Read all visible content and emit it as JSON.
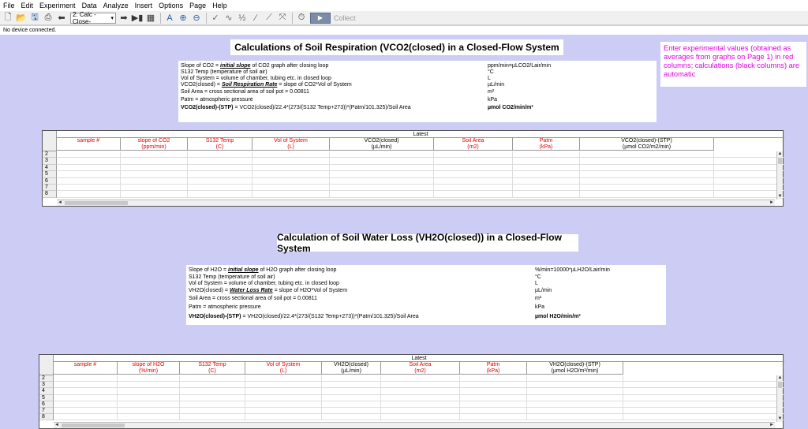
{
  "menu": [
    "File",
    "Edit",
    "Experiment",
    "Data",
    "Analyze",
    "Insert",
    "Options",
    "Page",
    "Help"
  ],
  "toolbar": {
    "page_select": "2: Calc - Close-",
    "collect_label": "Collect"
  },
  "status": "No device connected.",
  "section1": {
    "title": "Calculations of Soil Respiration (VCO2(closed) in a Closed-Flow System",
    "lines": [
      {
        "pre": "Slope of CO2 = ",
        "em": "initial slope",
        "post": " of CO2 graph after closing loop",
        "unit": "ppm/min=µLCO2/Lair/min"
      },
      {
        "pre": "S132 Temp (temperature of soil air)",
        "em": "",
        "post": "",
        "unit": "°C"
      },
      {
        "pre": "Vol of System = volume of chamber, tubing etc. in closed loop",
        "em": "",
        "post": "",
        "unit": "L"
      },
      {
        "pre": "VCO2(closed) = ",
        "em": "Soil Respiration Rate",
        "post": " = slope of CO2*Vol of System",
        "unit": "µL/min"
      },
      {
        "pre": "Soil Area = cross sectional area of soil pot = 0.00811",
        "em": "",
        "post": "",
        "unit": "m²"
      },
      {
        "pre": "Patm = atmospheric pressure",
        "em": "",
        "post": "",
        "unit": "kPa"
      }
    ],
    "formula": {
      "head": "VCO2(closed)-(STP)",
      "rest": " = VCO2(closed)/22.4*(273/(S132 Temp+273))*(Patm/101.325)/Soil Area",
      "unit": "µmol CO2/min/m²"
    },
    "latest": "Latest",
    "columns": [
      {
        "l1": "sample #",
        "l2": "",
        "red": true
      },
      {
        "l1": "slope of CO2",
        "l2": "(ppm/min)",
        "red": true
      },
      {
        "l1": "S132 Temp",
        "l2": "(C)",
        "red": true
      },
      {
        "l1": "Vol of System",
        "l2": "(L)",
        "red": true
      },
      {
        "l1": "VCO2(closed)",
        "l2": "(µL/min)",
        "red": false
      },
      {
        "l1": "Soil Area",
        "l2": "(m2)",
        "red": true
      },
      {
        "l1": "Patm",
        "l2": "(kPa)",
        "red": true
      },
      {
        "l1": "VCO2(closed)-(STP)",
        "l2": "(µmol CO2/m2/min)",
        "red": false
      }
    ],
    "rows": [
      "2",
      "3",
      "4",
      "5",
      "6",
      "7",
      "8"
    ]
  },
  "note": "Enter experimental values (obtained as averages from graphs on Page 1) in red columns; calculations (black columns) are automatic",
  "section2": {
    "title": "Calculation of Soil Water Loss (VH2O(closed)) in a Closed-Flow System",
    "lines": [
      {
        "pre": "Slope of H2O = ",
        "em": "initial slope",
        "post": " of H2O graph after closing loop",
        "unit": "%/min=10000*µLH2O/Lair/min"
      },
      {
        "pre": "S132 Temp (temperature of soil air)",
        "em": "",
        "post": "",
        "unit": "°C"
      },
      {
        "pre": "Vol of System = volume of chamber, tubing etc. in closed loop",
        "em": "",
        "post": "",
        "unit": "L"
      },
      {
        "pre": "VH2O(closed) = ",
        "em": "Water Loss Rate",
        "post": " = slope of H2O*Vol of System",
        "unit": "µL/min"
      },
      {
        "pre": "Soil Area = cross sectional area of soil pot = 0.00811",
        "em": "",
        "post": "",
        "unit": "m²"
      },
      {
        "pre": "Patm = atmospheric pressure",
        "em": "",
        "post": "",
        "unit": "kPa"
      }
    ],
    "formula": {
      "head": "VH2O(closed)-(STP)",
      "rest": " = VH2O(closed)/22.4*(273/(S132 Temp+273))*(Patm/101.325)/Soil Area",
      "unit": "µmol H2O/min/m²"
    },
    "latest": "Latest",
    "columns": [
      {
        "l1": "sample #",
        "l2": "",
        "red": true
      },
      {
        "l1": "slope of H2O",
        "l2": "(%/min)",
        "red": true
      },
      {
        "l1": "S132 Temp",
        "l2": "(C)",
        "red": true
      },
      {
        "l1": "Vol of System",
        "l2": "(L)",
        "red": true
      },
      {
        "l1": "VH2O(closed)",
        "l2": "(µL/min)",
        "red": false
      },
      {
        "l1": "Soil Area",
        "l2": "(m2)",
        "red": true
      },
      {
        "l1": "Patm",
        "l2": "(kPa)",
        "red": true
      },
      {
        "l1": "VH2O(closed)-(STP)",
        "l2": "(µmol H2O/m²/min)",
        "red": false
      }
    ],
    "rows": [
      "2",
      "3",
      "4",
      "5",
      "6",
      "7",
      "8"
    ]
  }
}
